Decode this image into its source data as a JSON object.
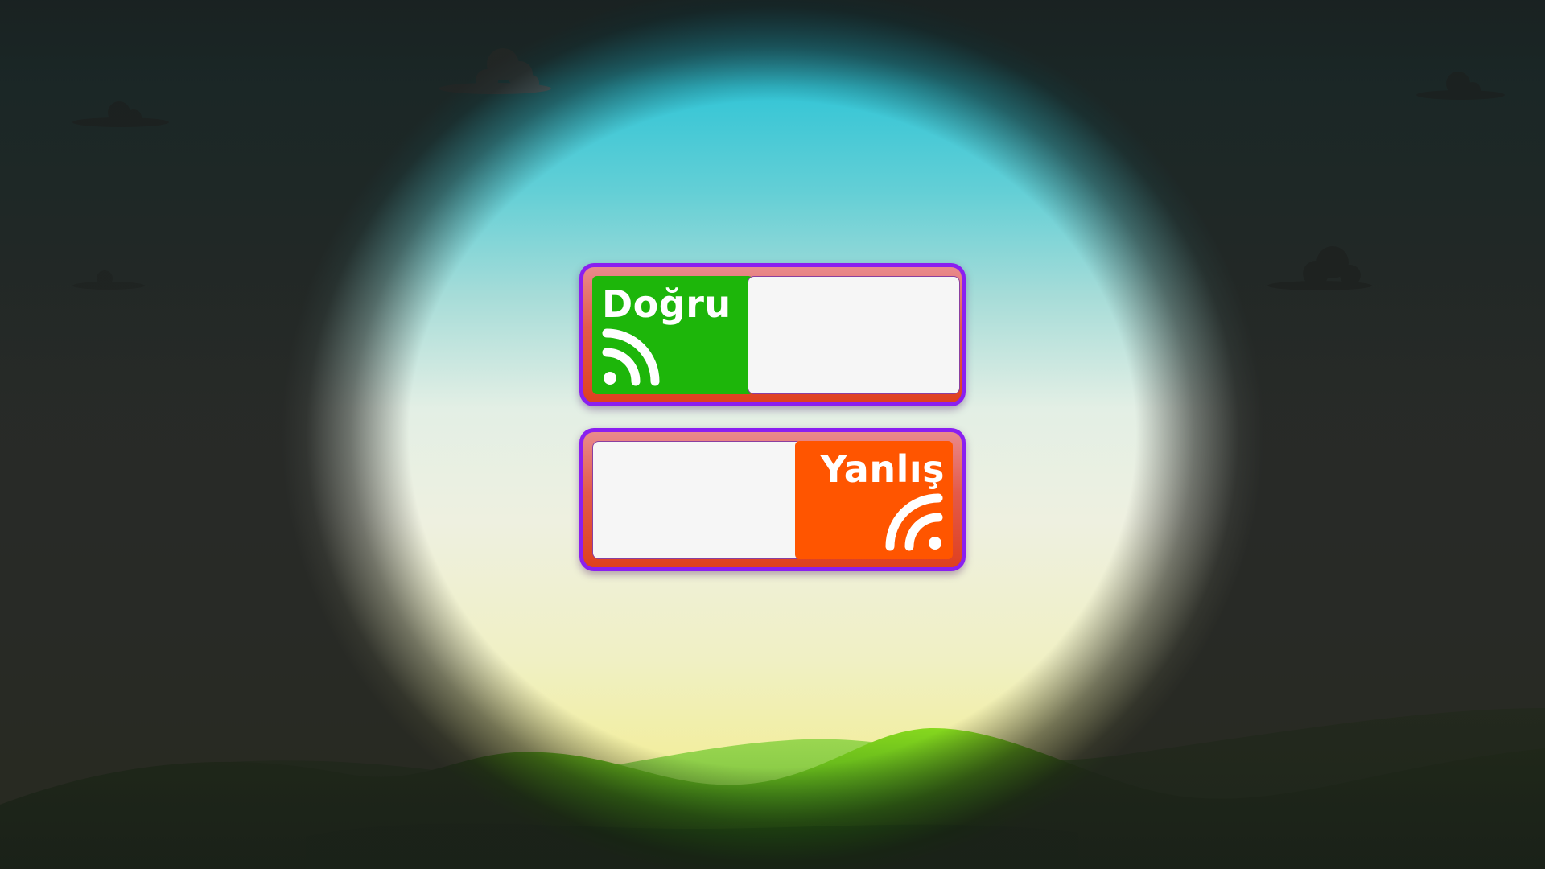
{
  "scene": {
    "sky_colors": [
      "#33c5d6",
      "#e3efe5",
      "#eef08a"
    ],
    "hill_colors": [
      "#7ed321",
      "#3f9a1c",
      "#1f6b12"
    ]
  },
  "panels": [
    {
      "id": "correct",
      "label": "Doğru",
      "label_color": "#1db60a",
      "icon": "rss-feed-icon",
      "slot_value": ""
    },
    {
      "id": "wrong",
      "label": "Yanlış",
      "label_color": "#ff5500",
      "icon": "rss-feed-icon",
      "slot_value": ""
    }
  ],
  "accent": {
    "panel_border": "#8a1ff0",
    "panel_fill": "#e35a4a"
  }
}
